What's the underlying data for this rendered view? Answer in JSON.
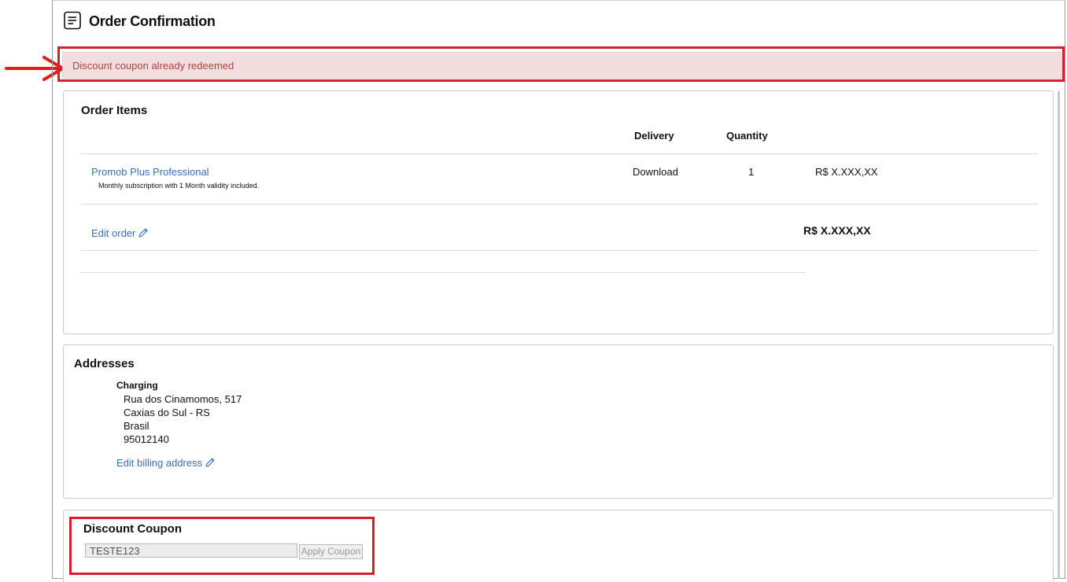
{
  "page": {
    "title": "Order Confirmation"
  },
  "alert": {
    "message": "Discount coupon already redeemed"
  },
  "order_items": {
    "title": "Order Items",
    "columns": {
      "delivery": "Delivery",
      "quantity": "Quantity"
    },
    "items": [
      {
        "name": "Promob Plus Professional",
        "description": "Monthly subscription with 1 Month validity included.",
        "delivery": "Download",
        "quantity": "1",
        "price": "R$ X.XXX,XX"
      }
    ],
    "edit_label": "Edit order",
    "total": "R$ X.XXX,XX"
  },
  "addresses": {
    "title": "Addresses",
    "charging": {
      "label": "Charging",
      "lines": [
        "Rua dos Cinamomos, 517",
        "Caxias do Sul - RS",
        "Brasil",
        "95012140"
      ]
    },
    "edit_label": "Edit billing address"
  },
  "coupon": {
    "title": "Discount Coupon",
    "value": "TESTE123",
    "button_label": "Apply Coupon"
  },
  "colors": {
    "annotation_red": "#d4202a",
    "alert_background": "#f2dede",
    "alert_text": "#a94442",
    "link": "#3a6fb8"
  },
  "icons": [
    "document-icon",
    "pencil-icon",
    "annotation-arrow-icon"
  ]
}
